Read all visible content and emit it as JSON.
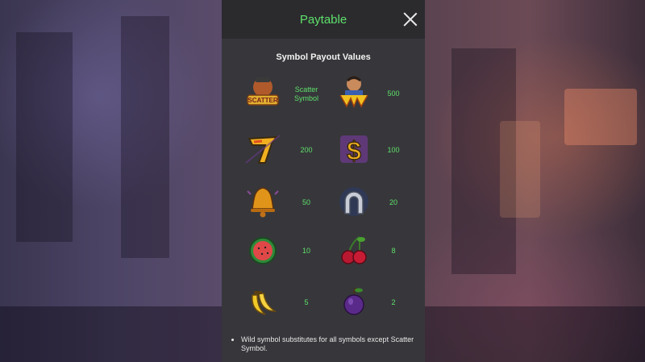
{
  "dialog": {
    "title": "Paytable",
    "close_icon": "close-icon",
    "subtitle": "Symbol Payout Values"
  },
  "symbols": [
    {
      "name": "scatter",
      "icon": "scatter-symbol-icon",
      "payout": "Scatter Symbol"
    },
    {
      "name": "wild",
      "icon": "wild-symbol-icon",
      "payout": "500"
    },
    {
      "name": "triple-seven",
      "icon": "seven-symbol-icon",
      "payout": "200"
    },
    {
      "name": "dollar",
      "icon": "dollar-symbol-icon",
      "payout": "100"
    },
    {
      "name": "bell",
      "icon": "bell-symbol-icon",
      "payout": "50"
    },
    {
      "name": "horseshoe",
      "icon": "horseshoe-symbol-icon",
      "payout": "20"
    },
    {
      "name": "watermelon",
      "icon": "watermelon-symbol-icon",
      "payout": "10"
    },
    {
      "name": "cherry",
      "icon": "cherry-symbol-icon",
      "payout": "8"
    },
    {
      "name": "banana",
      "icon": "banana-symbol-icon",
      "payout": "5"
    },
    {
      "name": "plum",
      "icon": "plum-symbol-icon",
      "payout": "2"
    }
  ],
  "rules": [
    "Wild symbol substitutes for all symbols except Scatter Symbol."
  ],
  "colors": {
    "accent": "#5ee06a",
    "panel": "#37373b",
    "header": "#2b2b2e"
  }
}
